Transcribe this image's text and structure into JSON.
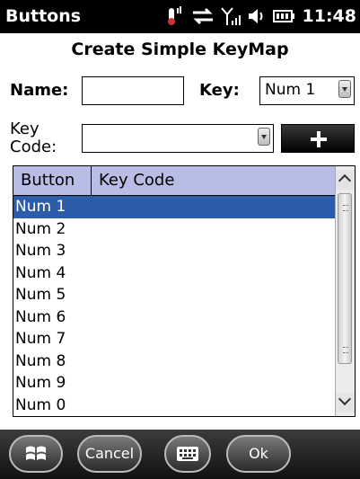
{
  "statusbar": {
    "app_title": "Buttons",
    "time": "11:48"
  },
  "form": {
    "title": "Create Simple KeyMap",
    "name_label": "Name:",
    "name_value": "",
    "key_label": "Key:",
    "key_value": "Num 1",
    "keycode_label_line1": "Key",
    "keycode_label_line2": "Code:",
    "keycode_value": ""
  },
  "list": {
    "columns": [
      "Button",
      "Key Code"
    ],
    "rows": [
      "Num 1",
      "Num 2",
      "Num 3",
      "Num 4",
      "Num 5",
      "Num 6",
      "Num 7",
      "Num 8",
      "Num 9",
      "Num 0"
    ],
    "selected_index": 0
  },
  "taskbar": {
    "cancel_label": "Cancel",
    "ok_label": "Ok"
  },
  "colors": {
    "selection": "#2d5ca8",
    "header": "#b8bde6",
    "statusbar": "#000000"
  }
}
